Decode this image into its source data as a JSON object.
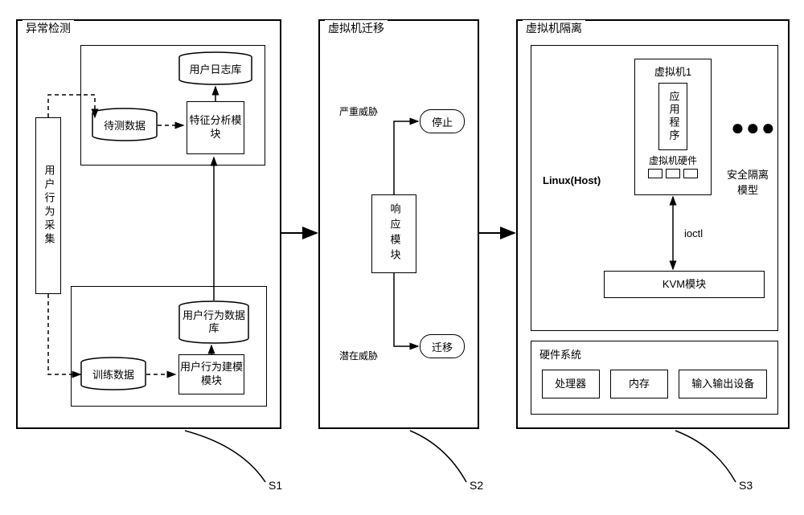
{
  "panels": {
    "p1": {
      "title": "异常检测",
      "label": "S1"
    },
    "p2": {
      "title": "虚拟机迁移",
      "label": "S2"
    },
    "p3": {
      "title": "虚拟机隔离",
      "label": "S3"
    }
  },
  "p1_nodes": {
    "collect": "用户行为采集",
    "pending": "待测数据",
    "analysis": "特征分析模块",
    "loglib": "用户日志库",
    "training": "训练数据",
    "modeling": "用户行为建模模块",
    "behaviordb": "用户行为数据库"
  },
  "p2_nodes": {
    "response": "响应模块",
    "stop": "停止",
    "migrate": "迁移",
    "severe": "严重威胁",
    "potential": "潜在威胁"
  },
  "p3_nodes": {
    "linux": "Linux(Host)",
    "vm1": "虚拟机1",
    "app": "应用程序",
    "vhw": "虚拟机硬件",
    "isolation": "安全隔离模型",
    "ioctl": "ioctl",
    "kvm": "KVM模块",
    "hw": "硬件系统",
    "cpu": "处理器",
    "mem": "内存",
    "io": "输入输出设备"
  }
}
